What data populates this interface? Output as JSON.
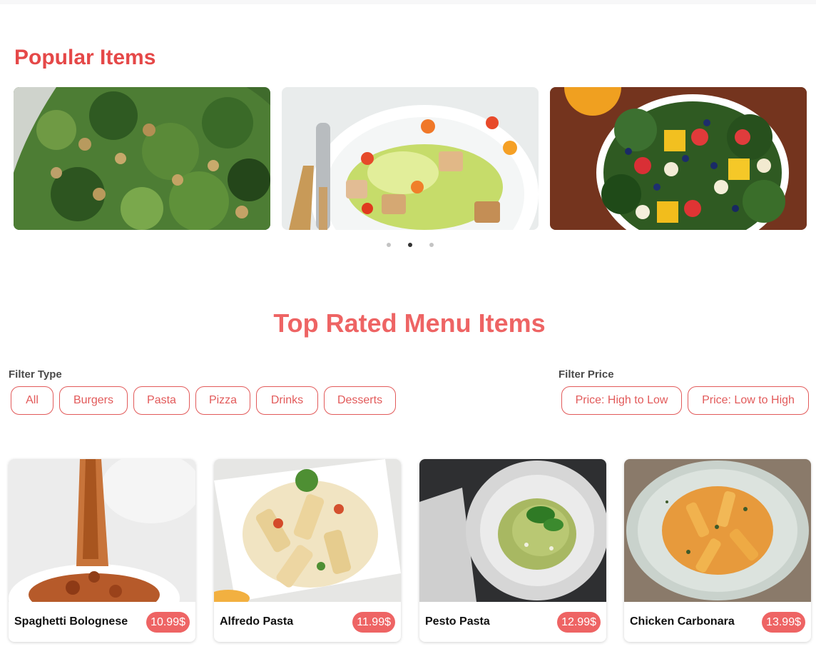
{
  "popular": {
    "title": "Popular Items",
    "slides": [
      {
        "name": "Kale chickpea salad"
      },
      {
        "name": "Caesar salad"
      },
      {
        "name": "Fruit spinach salad"
      }
    ],
    "active_dot": 2
  },
  "menu": {
    "title": "Top Rated Menu Items",
    "filter_type": {
      "label": "Filter Type",
      "options": [
        "All",
        "Burgers",
        "Pasta",
        "Pizza",
        "Drinks",
        "Desserts"
      ]
    },
    "filter_price": {
      "label": "Filter Price",
      "options": [
        "Price: High to Low",
        "Price: Low to High"
      ]
    },
    "items": [
      {
        "name": "Spaghetti Bolognese",
        "price": "10.99$"
      },
      {
        "name": "Alfredo Pasta",
        "price": "11.99$"
      },
      {
        "name": "Pesto Pasta",
        "price": "12.99$"
      },
      {
        "name": "Chicken Carbonara",
        "price": "13.99$"
      }
    ]
  },
  "colors": {
    "accent": "#e54848",
    "accent_light": "#ee6464",
    "pill_border": "#e25a5a",
    "label_gray": "#4a4a4a"
  }
}
